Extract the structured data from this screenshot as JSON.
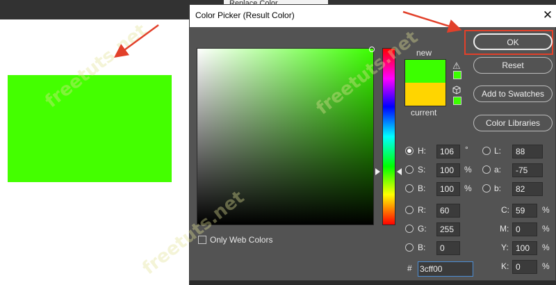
{
  "background": {
    "tab_title": "Replace Color",
    "swatch_color": "#44ff00"
  },
  "dialog": {
    "title": "Color Picker (Result Color)",
    "close_symbol": "✕",
    "new_label": "new",
    "current_label": "current",
    "new_color": "#3cff00",
    "current_color": "#ffd500",
    "gamut_warning_icon": "warning-triangle-icon",
    "web_safe_icon": "cube-icon",
    "buttons": {
      "ok": "OK",
      "reset": "Reset",
      "add_to_swatches": "Add to Swatches",
      "color_libraries": "Color Libraries"
    },
    "only_web_colors": "Only Web Colors",
    "hsb": {
      "h_label": "H:",
      "h_value": "106",
      "h_unit": "°",
      "s_label": "S:",
      "s_value": "100",
      "s_unit": "%",
      "b_label": "B:",
      "b_value": "100",
      "b_unit": "%"
    },
    "lab": {
      "l_label": "L:",
      "l_value": "88",
      "a_label": "a:",
      "a_value": "-75",
      "b_label": "b:",
      "b_value": "82"
    },
    "rgb": {
      "r_label": "R:",
      "r_value": "60",
      "g_label": "G:",
      "g_value": "255",
      "b_label": "B:",
      "b_value": "0"
    },
    "cmyk": {
      "c_label": "C:",
      "c_value": "59",
      "c_unit": "%",
      "m_label": "M:",
      "m_value": "0",
      "m_unit": "%",
      "y_label": "Y:",
      "y_value": "100",
      "y_unit": "%",
      "k_label": "K:",
      "k_value": "0",
      "k_unit": "%"
    },
    "hex_label": "#",
    "hex_value": "3cff00",
    "selected_mode": "H"
  },
  "watermark": "freetuts.net",
  "accent_colors": {
    "annotation_red": "#e2402a",
    "field_focus": "#4d8fd6"
  }
}
